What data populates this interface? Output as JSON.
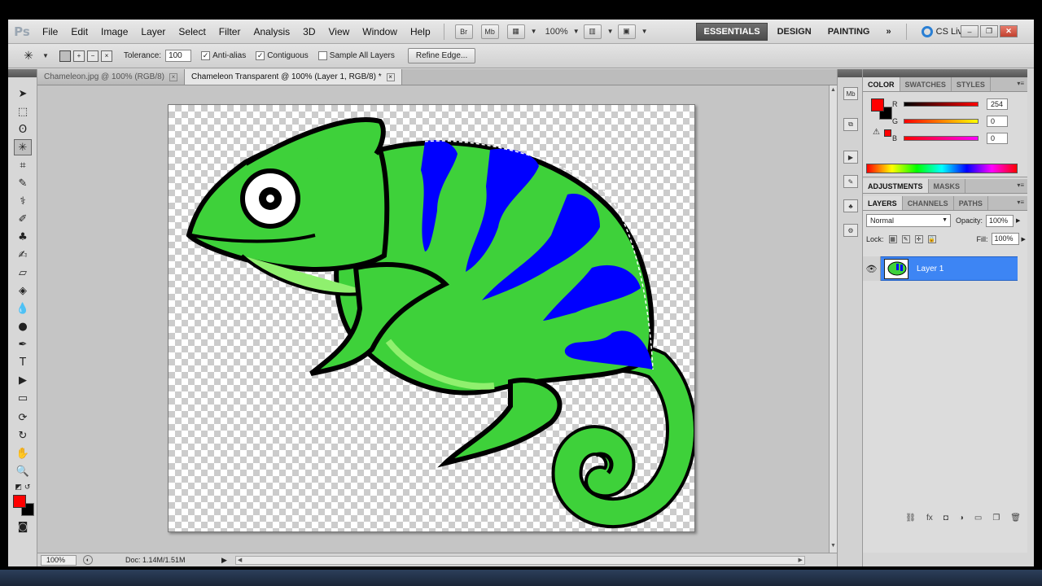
{
  "app": {
    "logo": "Ps"
  },
  "menu": [
    "File",
    "Edit",
    "Image",
    "Layer",
    "Select",
    "Filter",
    "Analysis",
    "3D",
    "View",
    "Window",
    "Help"
  ],
  "menubar_tools": {
    "bridge": "Br",
    "mini_bridge": "Mb",
    "zoom": "100%"
  },
  "workspaces": {
    "essentials": "ESSENTIALS",
    "design": "DESIGN",
    "painting": "PAINTING",
    "more": "»"
  },
  "cs_live": "CS Live",
  "window_controls": {
    "minimize": "–",
    "restore": "❐",
    "close": "✕"
  },
  "options": {
    "tolerance_label": "Tolerance:",
    "tolerance_value": "100",
    "anti_alias": "Anti-alias",
    "contiguous": "Contiguous",
    "sample_all_layers": "Sample All Layers",
    "refine_edge": "Refine Edge..."
  },
  "tabs": [
    {
      "label": "Chameleon.jpg @ 100% (RGB/8)",
      "close": "×"
    },
    {
      "label": "Chameleon Transparent @ 100% (Layer 1, RGB/8) *",
      "close": "×"
    }
  ],
  "status": {
    "zoom": "100%",
    "doc": "Doc: 1.14M/1.51M",
    "arrow": "▶"
  },
  "color_panel": {
    "tabs": [
      "COLOR",
      "SWATCHES",
      "STYLES"
    ],
    "r_label": "R",
    "g_label": "G",
    "b_label": "B",
    "r": "254",
    "g": "0",
    "b": "0",
    "foreground": "#ff0000",
    "background": "#000000"
  },
  "adjustments_tabs": [
    "ADJUSTMENTS",
    "MASKS"
  ],
  "layers_panel": {
    "tabs": [
      "LAYERS",
      "CHANNELS",
      "PATHS"
    ],
    "blend_mode": "Normal",
    "opacity_label": "Opacity:",
    "opacity": "100%",
    "lock_label": "Lock:",
    "fill_label": "Fill:",
    "fill": "100%",
    "layer_name": "Layer 1"
  },
  "colors": {
    "accent": "#3d85f4",
    "chameleon_green": "#3ed13a",
    "stripe_blue": "#0000ff"
  }
}
